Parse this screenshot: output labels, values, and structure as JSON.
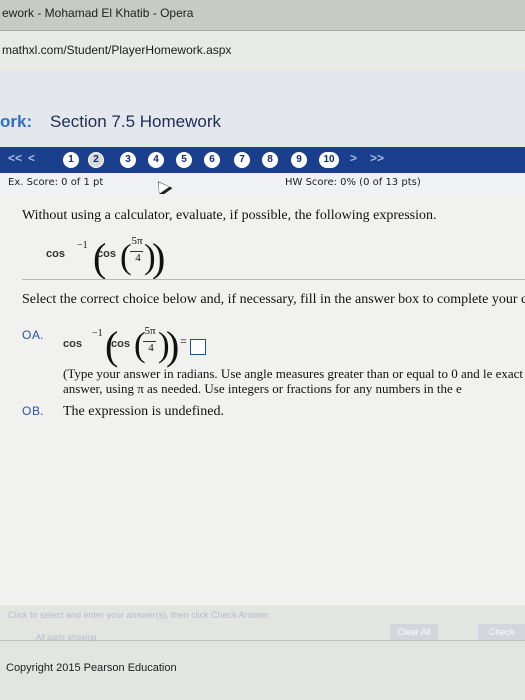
{
  "window": {
    "title": "ework - Mohamad El Khatib - Opera"
  },
  "browser": {
    "url": "mathxl.com/Student/PlayerHomework.aspx"
  },
  "header": {
    "prefix": "ork:",
    "title": "Section 7.5 Homework"
  },
  "nav": {
    "items": [
      "1",
      "2",
      "3",
      "4",
      "5",
      "6",
      "7",
      "8",
      "9",
      "10"
    ]
  },
  "score": {
    "ex": "Ex. Score: 0 of 1 pt",
    "hw": "HW Score: 0% (0 of 13 pts)"
  },
  "question": {
    "prompt": "Without using a calculator, evaluate, if possible, the following expression.",
    "select": "Select the correct choice below and, if necessary, fill in the answer box to complete your c",
    "choice_a_label": "A.",
    "choice_b_label": "B.",
    "choice_a_hint": "(Type your answer in radians. Use angle measures greater than or equal to 0 and le exact answer, using π as needed. Use integers or fractions for any numbers in the e",
    "choice_b_text": "The expression is undefined."
  },
  "footer": {
    "instruction": "Click to select and enter your answer(s), then click Check Answer.",
    "parts": "All parts showing",
    "clear_all": "Clear All",
    "check": "Check",
    "copyright": "Copyright 2015 Pearson Education"
  }
}
